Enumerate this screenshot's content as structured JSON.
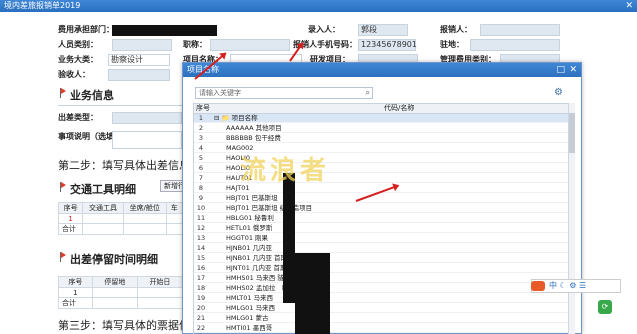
{
  "window": {
    "title": "境内差旅报销单2019",
    "close": "✕"
  },
  "form": {
    "expense_dept_label": "费用承担部门：",
    "entry_person_label": "录入人：",
    "entry_person_value": "郭段",
    "reimburser_label": "报销人：",
    "person_type_label": "人员类别：",
    "position_label": "职称：",
    "reimburser_phone_label": "报销人手机号码：",
    "reimburser_phone_value": "12345678901",
    "residence_label": "驻地：",
    "business_type_label": "业务大类：",
    "business_type_value": "勘察设计",
    "project_name_label": "项目名称：",
    "rd_project_label": "研发项目：",
    "mgmt_expense_label": "管理费用类别：",
    "acceptor_label": "验收人："
  },
  "business_section": {
    "title": "业务信息",
    "trip_type_label": "出差类型：",
    "remark_label": "事项说明（选填）："
  },
  "steps": {
    "step2": "第二步：填写具体出差信息。",
    "step3": "第三步：填写具体的票据信息"
  },
  "transport_section": {
    "title": "交通工具明细",
    "add_button": "新增行",
    "columns": [
      "序号",
      "交通工具",
      "坐席/舱位",
      "车"
    ],
    "rows": [
      [
        "1",
        "",
        "",
        ""
      ]
    ],
    "total_label": "合计"
  },
  "stay_section": {
    "title": "出差停留时间明细",
    "columns": [
      "序号",
      "停留地",
      "开始日"
    ],
    "rows": [
      [
        "1",
        "",
        ""
      ]
    ],
    "total_label": "合计"
  },
  "dialog": {
    "title": "项目名称",
    "search_placeholder": "请输入关键字",
    "col_seq": "序号",
    "col_code": "代码/名称",
    "rows": [
      {
        "n": "1",
        "text": "⊟ 📁 项目名称"
      },
      {
        "n": "2",
        "text": "AAAAAA  其他项目"
      },
      {
        "n": "3",
        "text": "BBBBBB  包干经费"
      },
      {
        "n": "4",
        "text": "MAG002  "
      },
      {
        "n": "5",
        "text": "HAOLI0  "
      },
      {
        "n": "6",
        "text": "HAOLI0  "
      },
      {
        "n": "7",
        "text": "HAUT01  "
      },
      {
        "n": "8",
        "text": "HAJT01  "
      },
      {
        "n": "9",
        "text": "HBJT01  巴基斯坦"
      },
      {
        "n": "10",
        "text": "HBJT01  巴基斯坦                    级改造项目"
      },
      {
        "n": "11",
        "text": "HBLG01  秘鲁利"
      },
      {
        "n": "12",
        "text": "HETL01  俄罗斯"
      },
      {
        "n": "13",
        "text": "HGGT01  刚果"
      },
      {
        "n": "14",
        "text": "HJNB01  几内亚"
      },
      {
        "n": "15",
        "text": "HJNB01  几内亚                  首期）"
      },
      {
        "n": "16",
        "text": "HJNT01  几内亚                  首期）"
      },
      {
        "n": "17",
        "text": "HMHS01  马来西                 隧道基础设施项目"
      },
      {
        "n": "18",
        "text": "HMHS02  孟加拉                  （首期）"
      },
      {
        "n": "19",
        "text": "HMLT01  马来西"
      },
      {
        "n": "20",
        "text": "HMLG01  马来西"
      },
      {
        "n": "21",
        "text": "HMLG01  蒙古"
      },
      {
        "n": "22",
        "text": "HMTI01  墨西哥"
      }
    ]
  },
  "watermark": "流浪者",
  "ime": {
    "text": "中 ☾ ⚙ ☰"
  },
  "colors": {
    "title_bar": "#3f87d6",
    "field_bg": "#dfe7f1",
    "flag": "#e23a2a",
    "arrow": "#d62020"
  }
}
